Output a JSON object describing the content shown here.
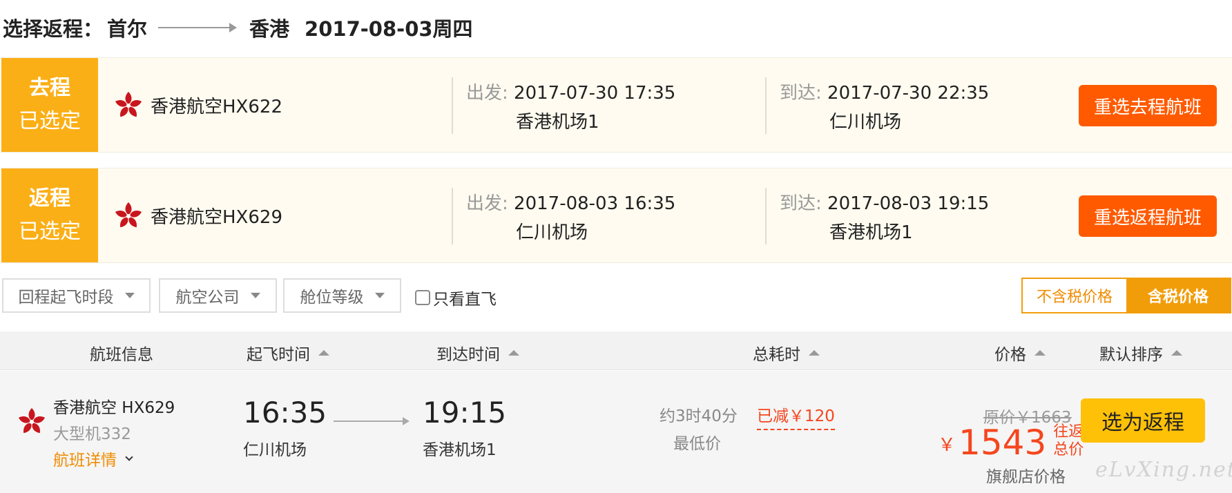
{
  "header": {
    "label": "选择返程：",
    "from_city": "首尔",
    "to_city": "香港",
    "date": "2017-08-03周四"
  },
  "outbound": {
    "tag_line1": "去程",
    "tag_line2": "已选定",
    "airline": "香港航空HX622",
    "depart_label": "出发:",
    "depart_time": "2017-07-30 17:35",
    "depart_airport": "香港机场1",
    "arrive_label": "到达:",
    "arrive_time": "2017-07-30 22:35",
    "arrive_airport": "仁川机场",
    "reselect_label": "重选去程航班"
  },
  "return": {
    "tag_line1": "返程",
    "tag_line2": "已选定",
    "airline": "香港航空HX629",
    "depart_label": "出发:",
    "depart_time": "2017-08-03 16:35",
    "depart_airport": "仁川机场",
    "arrive_label": "到达:",
    "arrive_time": "2017-08-03 19:15",
    "arrive_airport": "香港机场1",
    "reselect_label": "重选返程航班"
  },
  "filters": {
    "time_slot": "回程起飞时段",
    "airline": "航空公司",
    "cabin": "舱位等级",
    "direct_only": "只看直飞",
    "price_excl_tax": "不含税价格",
    "price_incl_tax": "含税价格"
  },
  "table_header": {
    "flight_info": "航班信息",
    "depart_time": "起飞时间",
    "arrive_time": "到达时间",
    "duration": "总耗时",
    "price": "价格",
    "default_sort": "默认排序"
  },
  "result": {
    "airline": "香港航空 HX629",
    "aircraft": "大型机332",
    "detail_link": "航班详情",
    "depart_time": "16:35",
    "depart_airport": "仁川机场",
    "arrive_time": "19:15",
    "arrive_airport": "香港机场1",
    "duration": "约3时40分",
    "lowest_tag": "最低价",
    "discount": "已减￥120",
    "original_price": "原价￥1663",
    "currency": "￥",
    "price": "1543",
    "price_unit_1": "往返",
    "price_unit_2": "总价",
    "shop_price": "旗舰店价格",
    "select_label": "选为返程"
  },
  "watermark": "eLvXing.net",
  "colors": {
    "tag_orange": "#fbaf16",
    "reselect_button": "#ff5a00",
    "tax_toggle": "#f19d0a",
    "price_red": "#f5461e",
    "select_button": "#ffc107"
  },
  "icons": {
    "airline_logo": "hong-kong-airlines-bauhinia-icon"
  }
}
